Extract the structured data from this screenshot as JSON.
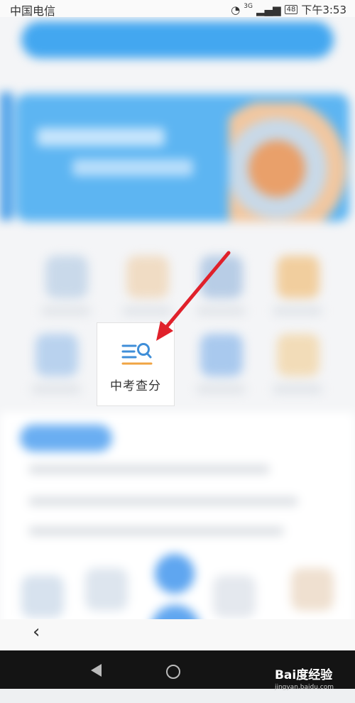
{
  "status_bar": {
    "carrier": "中国电信",
    "network": "3G",
    "battery": "48",
    "time": "下午3:53"
  },
  "highlight": {
    "label": "中考查分",
    "icon": "search-list-icon"
  },
  "watermark": {
    "brand": "Bai度经验",
    "url": "jingyan.baidu.com"
  },
  "colors": {
    "accent": "#3f8ed8",
    "arrow": "#e0212b",
    "icon_line": "#f0a443",
    "primary_blue": "#43a7f0"
  }
}
